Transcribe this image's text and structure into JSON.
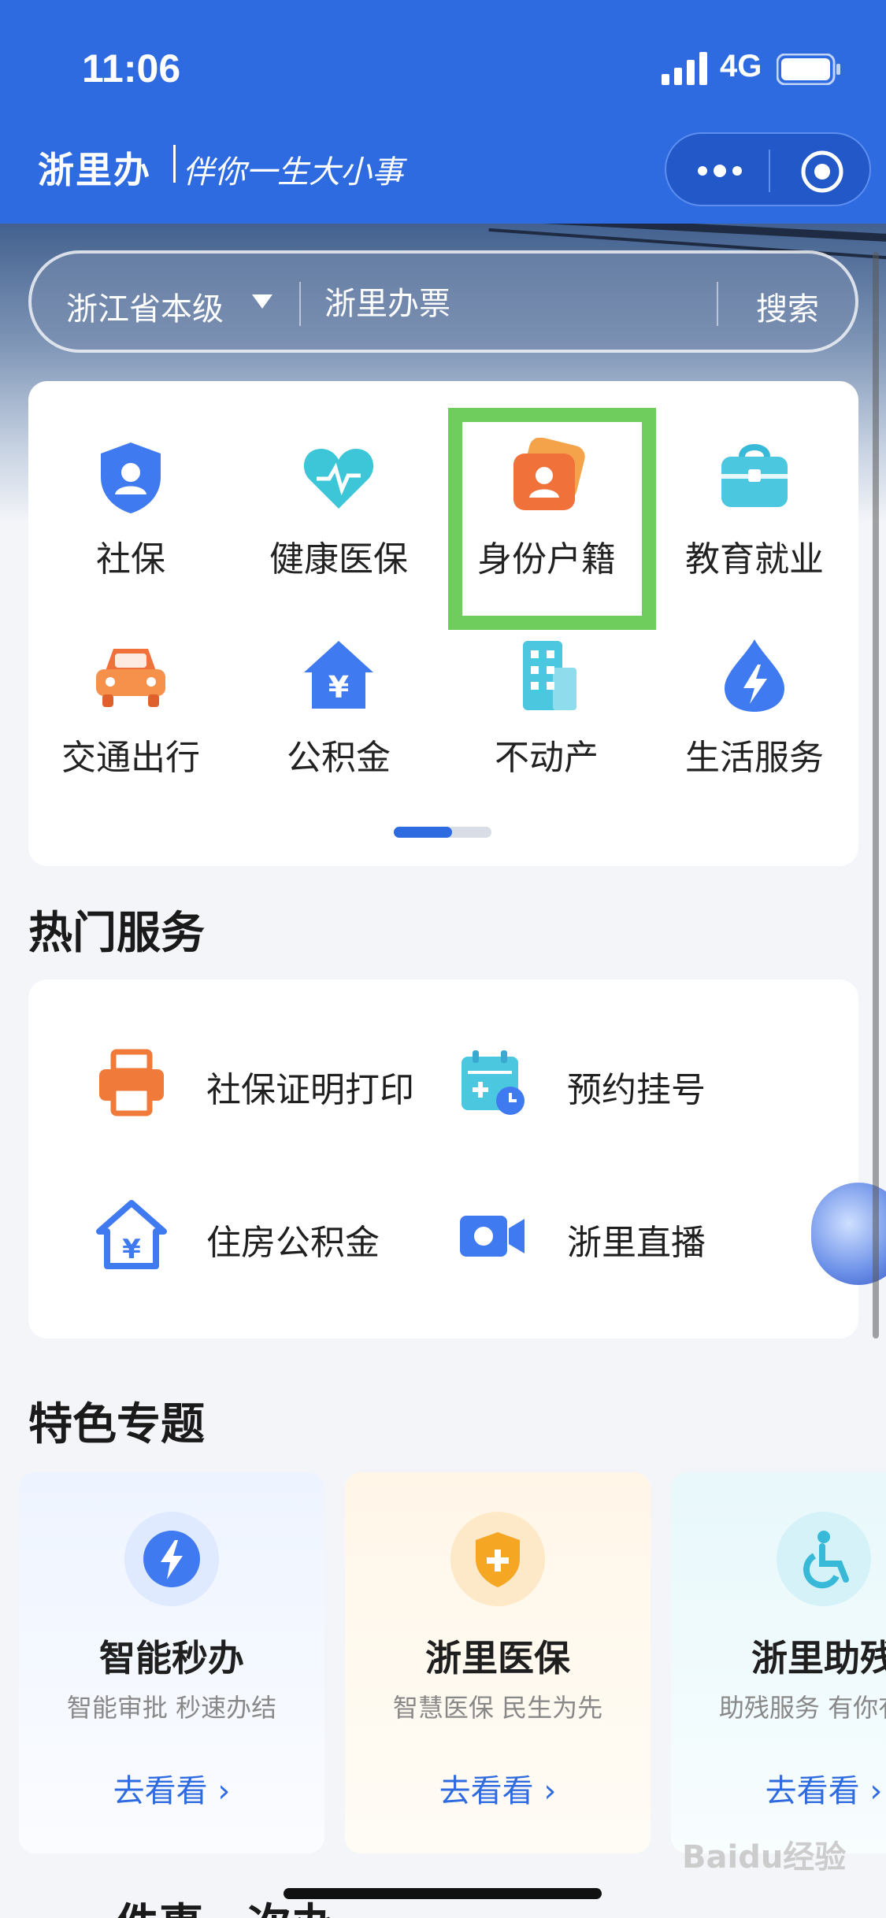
{
  "status_bar": {
    "time": "11:06",
    "network": "4G"
  },
  "header": {
    "app_name": "浙里办",
    "slogan": "伴你一生大小事"
  },
  "search": {
    "region": "浙江省本级",
    "placeholder": "浙里办票",
    "button": "搜索"
  },
  "categories": [
    {
      "label": "社保",
      "icon": "shield-person-icon"
    },
    {
      "label": "健康医保",
      "icon": "heart-pulse-icon"
    },
    {
      "label": "身份户籍",
      "icon": "id-card-icon"
    },
    {
      "label": "教育就业",
      "icon": "briefcase-icon"
    },
    {
      "label": "交通出行",
      "icon": "car-icon"
    },
    {
      "label": "公积金",
      "icon": "house-yen-icon"
    },
    {
      "label": "不动产",
      "icon": "building-icon"
    },
    {
      "label": "生活服务",
      "icon": "lightning-drop-icon"
    }
  ],
  "hot_services": {
    "title": "热门服务",
    "items": [
      {
        "label": "社保证明打印",
        "icon": "printer-icon"
      },
      {
        "label": "预约挂号",
        "icon": "calendar-plus-icon"
      },
      {
        "label": "住房公积金",
        "icon": "house-yen-icon"
      },
      {
        "label": "浙里直播",
        "icon": "video-camera-icon"
      }
    ]
  },
  "topics": {
    "title": "特色专题",
    "items": [
      {
        "title": "智能秒办",
        "subtitle": "智能审批 秒速办结",
        "link": "去看看 ›",
        "icon": "lightning-icon"
      },
      {
        "title": "浙里医保",
        "subtitle": "智慧医保 民生为先",
        "link": "去看看 ›",
        "icon": "medical-shield-icon"
      },
      {
        "title": "浙里助残",
        "subtitle": "助残服务 有你有我",
        "link": "去看看 ›",
        "icon": "wheelchair-icon"
      }
    ]
  },
  "next_section_title": "一件事一次办",
  "watermark": "Baidu经验",
  "colors": {
    "brand_blue": "#2f6be0",
    "highlight_green": "#6fcd5e",
    "orange": "#f07a3a"
  }
}
